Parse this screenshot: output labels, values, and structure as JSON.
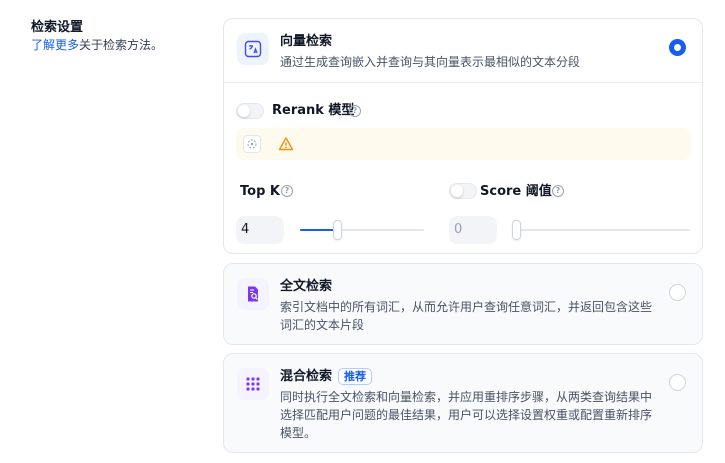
{
  "section": {
    "title": "检索设置",
    "link_text": "了解更多",
    "desc_suffix": "关于检索方法。"
  },
  "methods": [
    {
      "title": "向量检索",
      "description": "通过生成查询嵌入并查询与其向量表示最相似的文本分段",
      "selected": true,
      "icon": "vector-search-icon"
    },
    {
      "title": "全文检索",
      "description": "索引文档中的所有词汇，从而允许用户查询任意词汇，并返回包含这些词汇的文本片段",
      "selected": false,
      "icon": "fulltext-search-icon"
    },
    {
      "title": "混合检索",
      "badge": "推荐",
      "description": "同时执行全文检索和向量检索，并应用重排序步骤，从两类查询结果中选择匹配用户问题的最佳结果，用户可以选择设置权重或配置重新排序模型。",
      "selected": false,
      "icon": "hybrid-grid-icon"
    }
  ],
  "vector_settings": {
    "rerank_label": "Rerank 模型",
    "rerank_enabled": false,
    "top_k_label": "Top K",
    "top_k_value": "4",
    "top_k_fraction": 0.3,
    "score_label": "Score 阈值",
    "score_enabled": false,
    "score_value": "0",
    "score_fraction": 0
  },
  "colors": {
    "accent": "#155eef",
    "warning_bg": "#fefaed",
    "warning_icon": "#f79009",
    "icon_bg_purple": "#eef4ff",
    "icon_bg_violet": "#f4f3ff"
  }
}
